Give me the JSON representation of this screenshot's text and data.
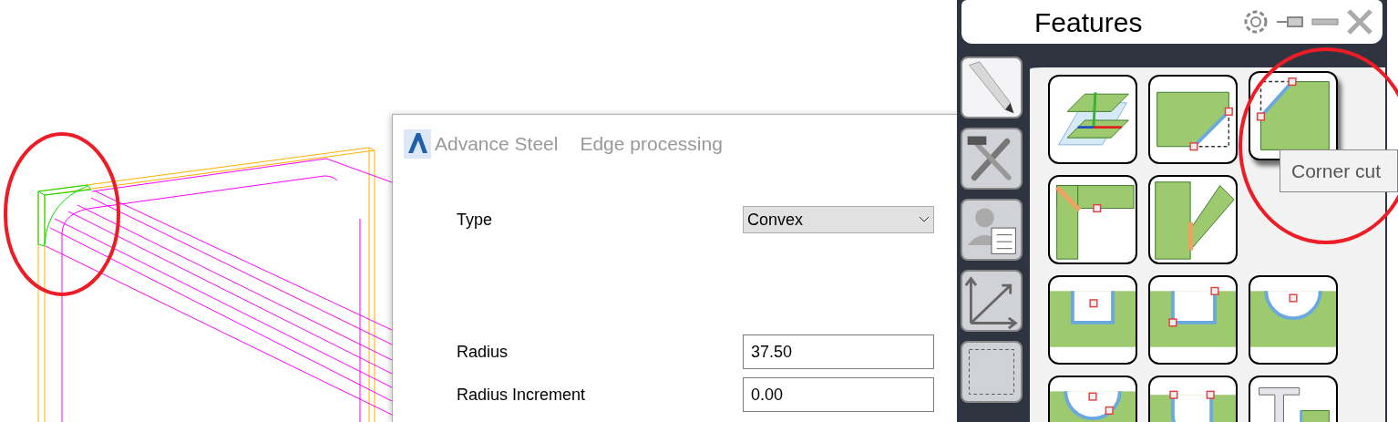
{
  "dialog": {
    "app_title": "Advance Steel",
    "title": "Edge processing",
    "fields": [
      {
        "kind": "select",
        "label": "Type",
        "value": "Convex"
      },
      {
        "kind": "spacer"
      },
      {
        "kind": "input",
        "label": "Radius",
        "value": "37.50"
      },
      {
        "kind": "input",
        "label": "Radius Increment",
        "value": "0.00"
      }
    ]
  },
  "features": {
    "title": "Features",
    "tools": [
      {
        "kind": "pencil",
        "selected": true
      },
      {
        "kind": "tools",
        "selected": false
      },
      {
        "kind": "user-list",
        "selected": false
      },
      {
        "kind": "axes",
        "selected": false
      },
      {
        "kind": "dashed-rect",
        "selected": false
      }
    ],
    "tiles": [
      {
        "kind": "axes",
        "highlighted": false
      },
      {
        "kind": "edge-cut",
        "highlighted": false
      },
      {
        "kind": "corner-cut",
        "highlighted": true
      },
      {
        "kind": "miter",
        "highlighted": false
      },
      {
        "kind": "saw-cut",
        "highlighted": false
      },
      {
        "kind": "empty"
      },
      {
        "kind": "rect-notch",
        "highlighted": false
      },
      {
        "kind": "rect-notch-corner",
        "highlighted": false
      },
      {
        "kind": "arc-notch",
        "highlighted": false
      },
      {
        "kind": "arc-notch-point",
        "highlighted": false
      },
      {
        "kind": "round-notch",
        "highlighted": false
      },
      {
        "kind": "beam-plate",
        "highlighted": false
      }
    ],
    "tooltip": "Corner cut"
  }
}
